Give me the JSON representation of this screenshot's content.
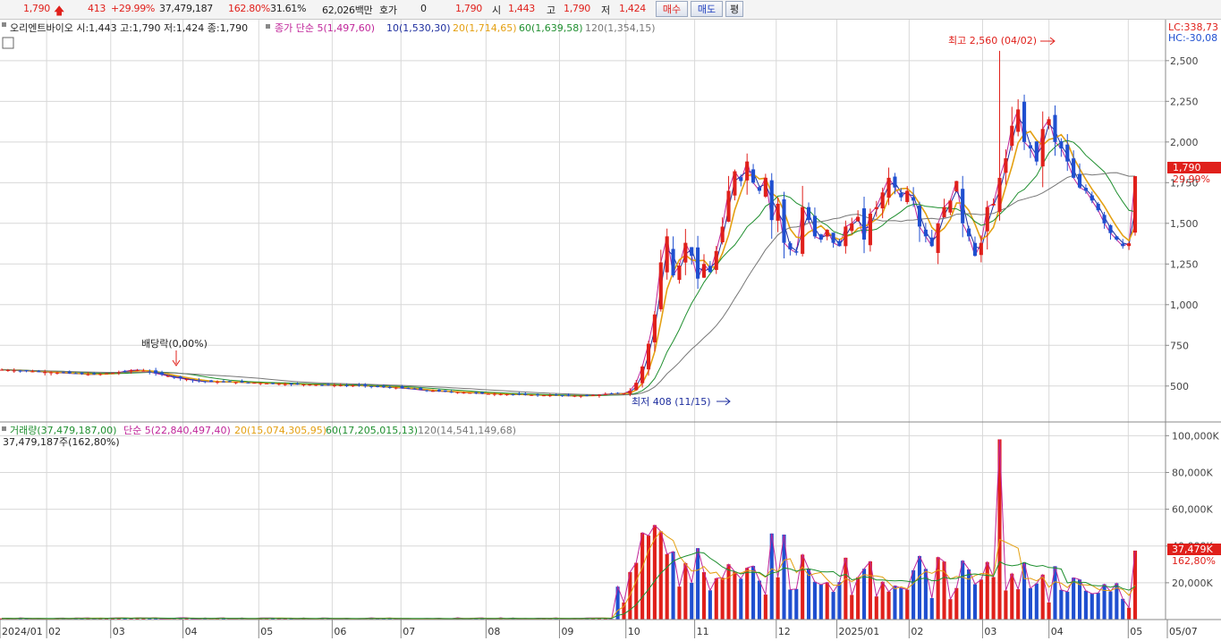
{
  "quote_bar": {
    "price": "1,790",
    "change": "413",
    "change_pct": "+29.99%",
    "volume": "37,479,187",
    "volume_ratio": "162.80%",
    "turnover_pct": "31.61%",
    "trade_amount": "62,026백만",
    "hoga_label": "호가",
    "hoga_value": "0",
    "hoga_price": "1,790",
    "open_label": "시",
    "open_value": "1,443",
    "high_label": "고",
    "high_value": "1,790",
    "low_label": "저",
    "low_value": "1,424",
    "buy_label": "매수",
    "sell_label": "매도",
    "eval_label": "평"
  },
  "price_legend": {
    "stock": "오리엔트바이오 시:1,443 고:1,790 저:1,424 종:1,790",
    "ma_title": "종가 단순 5(1,497,60)",
    "ma10": "10(1,530,30)",
    "ma20": "20(1,714,65)",
    "ma60": "60(1,639,58)",
    "ma120": "120(1,354,15)",
    "lc": "LC:338,73",
    "hc": "HC:-30,08"
  },
  "volume_legend": {
    "title": "거래량(37,479,187,00)",
    "ma5": "단순 5(22,840,497,40)",
    "ma20": "20(15,074,305,95)",
    "ma60": "60(17,205,015,13)",
    "ma120": "120(14,541,149,68)",
    "current": "37,479,187주(162,80%)"
  },
  "annotations": {
    "high": "최고 2,560 (04/02)",
    "low": "최저 408 (11/15)",
    "dividend": "배당락(0,00%)",
    "price_tag": "1,790",
    "price_tag_pct": "29,99%",
    "vol_tag": "37,479K",
    "vol_tag_pct": "162,80%"
  },
  "chart_data": [
    {
      "type": "candlestick",
      "name": "price",
      "y_ticks": [
        "2,500",
        "2,250",
        "2,000",
        "1,750",
        "1,500",
        "1,250",
        "1,000",
        "750",
        "500"
      ],
      "y_tick_values": [
        2500,
        2250,
        2000,
        1750,
        1500,
        1250,
        1000,
        750,
        500
      ],
      "ylim": [
        290,
        2620
      ],
      "x_ticks": [
        "2024/01",
        "02",
        "03",
        "04",
        "05",
        "06",
        "07",
        "08",
        "09",
        "10",
        "11",
        "12",
        "2025/01",
        "02",
        "03",
        "04",
        "05",
        "05/07"
      ],
      "x_tick_fracs": [
        0.0,
        0.04,
        0.095,
        0.157,
        0.222,
        0.285,
        0.344,
        0.417,
        0.48,
        0.537,
        0.596,
        0.666,
        0.718,
        0.78,
        0.843,
        0.9,
        0.968,
        1.0
      ],
      "close": [
        600,
        598,
        596,
        594,
        592,
        590,
        588,
        586,
        584,
        582,
        580,
        578,
        576,
        574,
        572,
        572,
        574,
        578,
        580,
        584,
        590,
        596,
        598,
        594,
        586,
        578,
        570,
        562,
        554,
        548,
        542,
        536,
        530,
        528,
        526,
        526,
        525,
        524,
        524,
        522,
        520,
        520,
        518,
        516,
        515,
        514,
        512,
        511,
        510,
        510,
        510,
        508,
        506,
        506,
        505,
        505,
        504,
        503,
        502,
        500,
        498,
        496,
        494,
        492,
        490,
        486,
        484,
        480,
        476,
        472,
        470,
        468,
        466,
        464,
        462,
        460,
        458,
        456,
        454,
        452,
        452,
        450,
        449,
        448,
        447,
        446,
        445,
        444,
        443,
        443,
        442,
        441,
        440,
        440,
        440,
        442,
        444,
        446,
        450,
        452,
        454,
        455,
        470,
        520,
        620,
        760,
        940,
        1260,
        1420,
        1180,
        1240,
        1380,
        1300,
        1160,
        1250,
        1200,
        1330,
        1480,
        1700,
        1820,
        1760,
        1880,
        1750,
        1700,
        1780,
        1520,
        1620,
        1380,
        1340,
        1320,
        1600,
        1520,
        1420,
        1400,
        1460,
        1380,
        1360,
        1480,
        1500,
        1540,
        1400,
        1560,
        1600,
        1690,
        1780,
        1720,
        1660,
        1700,
        1640,
        1480,
        1420,
        1360,
        1500,
        1600,
        1640,
        1760,
        1500,
        1420,
        1300,
        1380,
        1600,
        1620,
        1780,
        1900,
        2100,
        2200,
        2000,
        1960,
        1880,
        2080,
        2140,
        2000,
        1960,
        1880,
        1780,
        1720,
        1700,
        1640,
        1580,
        1500,
        1440,
        1400,
        1360,
        1377,
        1790
      ],
      "ma_series": [
        {
          "name": "5",
          "color": "#c0269a",
          "values": []
        },
        {
          "name": "10",
          "color": "#1f2f9f",
          "values": []
        },
        {
          "name": "20",
          "color": "#e4a012",
          "values": []
        },
        {
          "name": "60",
          "color": "#1f8f2f",
          "values": []
        },
        {
          "name": "120",
          "color": "#777777",
          "values": []
        }
      ],
      "high_point": {
        "value": 2560,
        "date": "04/02"
      },
      "low_point": {
        "value": 408,
        "date": "11/15"
      }
    },
    {
      "type": "bar",
      "name": "volume",
      "y_ticks": [
        "100,000K",
        "80,000K",
        "60,000K",
        "40,000K",
        "20,000K"
      ],
      "y_tick_values": [
        100000,
        80000,
        60000,
        40000,
        20000
      ],
      "ylim": [
        0,
        106000
      ],
      "unit": "K"
    }
  ],
  "colors": {
    "up": "#e0201b",
    "down": "#1f4fd0",
    "grid": "#d8d8d8",
    "axis": "#555555"
  }
}
